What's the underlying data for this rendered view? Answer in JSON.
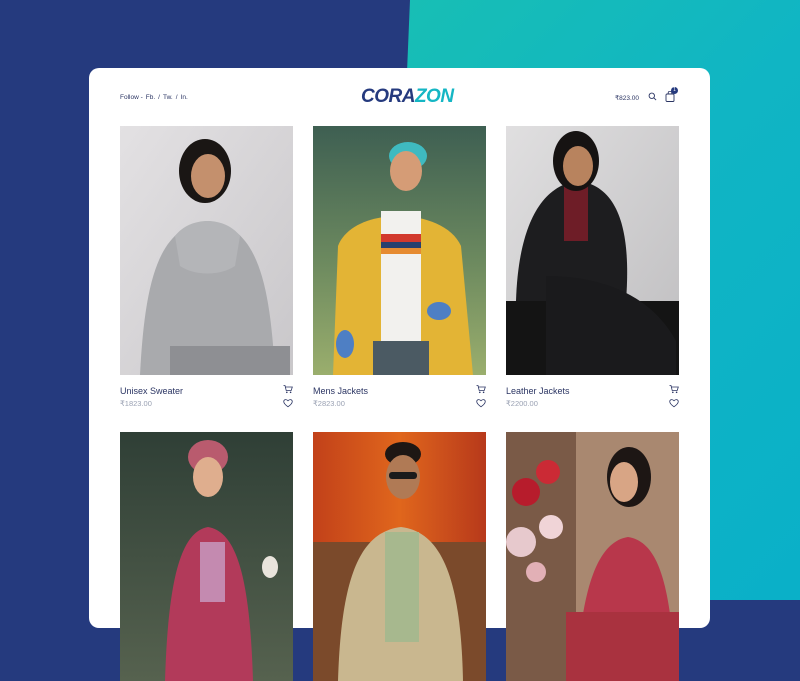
{
  "header": {
    "follow_label": "Follow -",
    "social": [
      "Fb.",
      "/",
      "Tw.",
      "/",
      "In."
    ],
    "logo_part1": "CORA",
    "logo_part2": "ZON",
    "cart_total": "₹823.00",
    "cart_count": "1"
  },
  "products": [
    {
      "name": "Unisex Sweater",
      "price": "₹1823.00"
    },
    {
      "name": "Mens Jackets",
      "price": "₹2823.00"
    },
    {
      "name": "Leather Jackets",
      "price": "₹2200.00"
    },
    {
      "name": "",
      "price": ""
    },
    {
      "name": "",
      "price": ""
    },
    {
      "name": "",
      "price": ""
    }
  ],
  "colors": {
    "brand_navy": "#253a7e",
    "brand_teal": "#15b6c4"
  },
  "icons": [
    "search-icon",
    "shopping-bag-icon",
    "cart-icon",
    "heart-icon"
  ]
}
